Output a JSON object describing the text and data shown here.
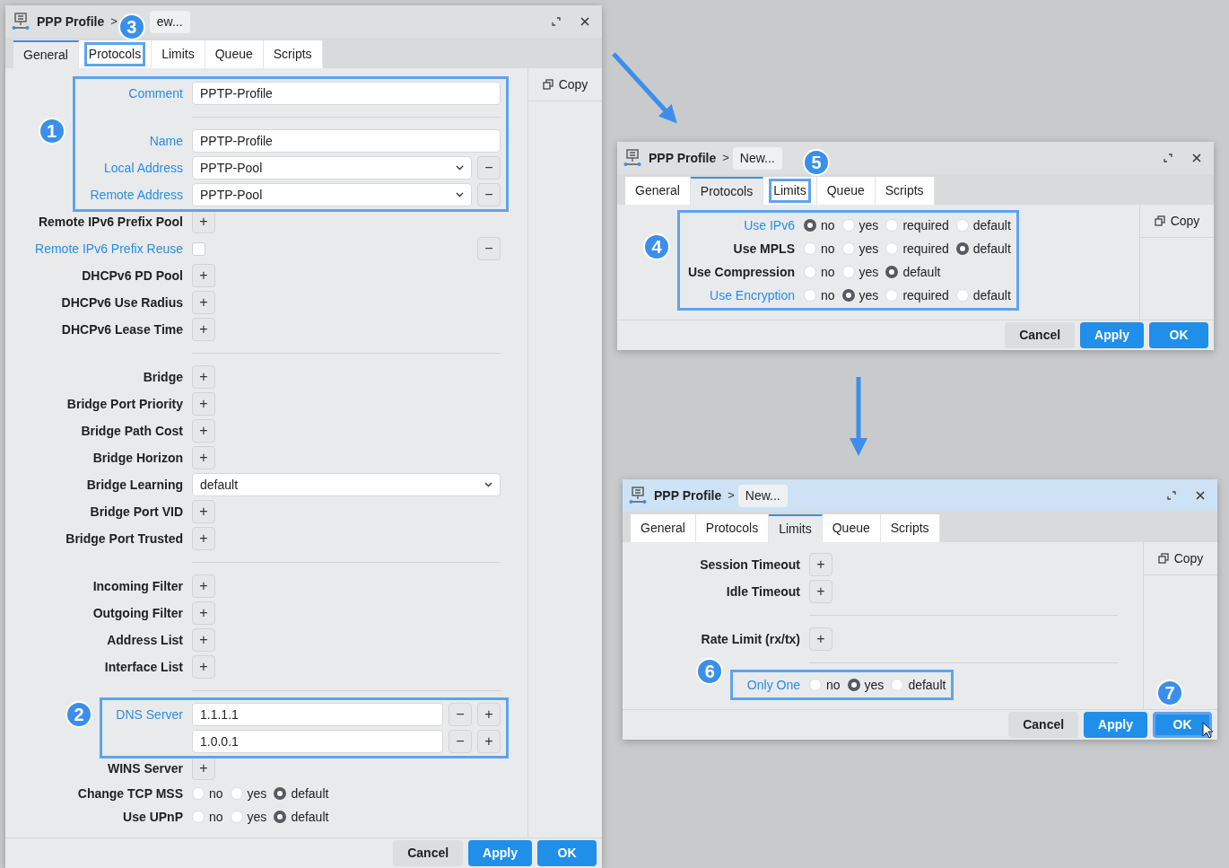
{
  "windows": [
    {
      "active": false,
      "title": "PPP Profile",
      "separator": ">",
      "breadcrumb": "ew...",
      "tabs": [
        {
          "label": "General",
          "selected": true,
          "outlined": false
        },
        {
          "label": "Protocols",
          "selected": false,
          "outlined": true,
          "badge": "3"
        },
        {
          "label": "Limits",
          "selected": false,
          "outlined": false
        },
        {
          "label": "Queue",
          "selected": false,
          "outlined": false
        },
        {
          "label": "Scripts",
          "selected": false,
          "outlined": false
        }
      ],
      "side_button": "Copy",
      "rows": [
        {
          "kind": "group",
          "badge": "1",
          "rows": [
            {
              "kind": "field",
              "label": "Comment",
              "set": true,
              "value": "PPTP-Profile",
              "actions": []
            },
            {
              "kind": "divider"
            },
            {
              "kind": "field",
              "label": "Name",
              "set": true,
              "value": "PPTP-Profile",
              "actions": []
            },
            {
              "kind": "select",
              "label": "Local Address",
              "set": true,
              "value": "PPTP-Pool",
              "actions": [
                "−"
              ]
            },
            {
              "kind": "select",
              "label": "Remote Address",
              "set": true,
              "value": "PPTP-Pool",
              "actions": [
                "−"
              ]
            }
          ]
        },
        {
          "kind": "empty",
          "label": "Remote IPv6 Prefix Pool",
          "set": false,
          "actions": [
            "+"
          ]
        },
        {
          "kind": "checkbox",
          "label": "Remote IPv6 Prefix Reuse",
          "set": true,
          "checked": false,
          "actions": [
            "−"
          ]
        },
        {
          "kind": "empty",
          "label": "DHCPv6 PD Pool",
          "set": false,
          "actions": [
            "+"
          ]
        },
        {
          "kind": "empty",
          "label": "DHCPv6 Use Radius",
          "set": false,
          "actions": [
            "+"
          ]
        },
        {
          "kind": "empty",
          "label": "DHCPv6 Lease Time",
          "set": false,
          "actions": [
            "+"
          ]
        },
        {
          "kind": "divider"
        },
        {
          "kind": "empty",
          "label": "Bridge",
          "set": false,
          "actions": [
            "+"
          ]
        },
        {
          "kind": "empty",
          "label": "Bridge Port Priority",
          "set": false,
          "actions": [
            "+"
          ]
        },
        {
          "kind": "empty",
          "label": "Bridge Path Cost",
          "set": false,
          "actions": [
            "+"
          ]
        },
        {
          "kind": "empty",
          "label": "Bridge Horizon",
          "set": false,
          "actions": [
            "+"
          ]
        },
        {
          "kind": "select",
          "label": "Bridge Learning",
          "set": false,
          "value": "default",
          "actions": []
        },
        {
          "kind": "empty",
          "label": "Bridge Port VID",
          "set": false,
          "actions": [
            "+"
          ]
        },
        {
          "kind": "empty",
          "label": "Bridge Port Trusted",
          "set": false,
          "actions": [
            "+"
          ]
        },
        {
          "kind": "divider"
        },
        {
          "kind": "empty",
          "label": "Incoming Filter",
          "set": false,
          "actions": [
            "+"
          ]
        },
        {
          "kind": "empty",
          "label": "Outgoing Filter",
          "set": false,
          "actions": [
            "+"
          ]
        },
        {
          "kind": "empty",
          "label": "Address List",
          "set": false,
          "actions": [
            "+"
          ]
        },
        {
          "kind": "empty",
          "label": "Interface List",
          "set": false,
          "actions": [
            "+"
          ]
        },
        {
          "kind": "divider"
        },
        {
          "kind": "group",
          "badge": "2",
          "rows": [
            {
              "kind": "field",
              "label": "DNS Server",
              "set": true,
              "value": "1.1.1.1",
              "actions": [
                "−",
                "+"
              ]
            },
            {
              "kind": "field",
              "value": "1.0.0.1",
              "actions": [
                "−",
                "+"
              ]
            }
          ]
        },
        {
          "kind": "empty",
          "label": "WINS Server",
          "set": false,
          "actions": [
            "+"
          ]
        },
        {
          "kind": "radio",
          "label": "Change TCP MSS",
          "set": false,
          "options": [
            {
              "label": "no",
              "selected": false
            },
            {
              "label": "yes",
              "selected": false
            },
            {
              "label": "default",
              "selected": true
            }
          ]
        },
        {
          "kind": "radio",
          "label": "Use UPnP",
          "set": false,
          "options": [
            {
              "label": "no",
              "selected": false
            },
            {
              "label": "yes",
              "selected": false
            },
            {
              "label": "default",
              "selected": true
            }
          ]
        }
      ],
      "buttons": [
        {
          "label": "Cancel",
          "kind": "secondary",
          "outlined": false
        },
        {
          "label": "Apply",
          "kind": "primary",
          "outlined": false
        },
        {
          "label": "OK",
          "kind": "primary",
          "outlined": false
        }
      ]
    },
    {
      "active": false,
      "title": "PPP Profile",
      "separator": ">",
      "breadcrumb": "New...",
      "tabs": [
        {
          "label": "General",
          "selected": false,
          "outlined": false
        },
        {
          "label": "Protocols",
          "selected": true,
          "outlined": false
        },
        {
          "label": "Limits",
          "selected": false,
          "outlined": true,
          "badge": "5"
        },
        {
          "label": "Queue",
          "selected": false,
          "outlined": false
        },
        {
          "label": "Scripts",
          "selected": false,
          "outlined": false
        }
      ],
      "side_button": "Copy",
      "rows": [
        {
          "kind": "group",
          "badge": "4",
          "rows": [
            {
              "kind": "radio",
              "label": "Use IPv6",
              "set": true,
              "options": [
                {
                  "label": "no",
                  "selected": true
                },
                {
                  "label": "yes",
                  "selected": false
                },
                {
                  "label": "required",
                  "selected": false
                },
                {
                  "label": "default",
                  "selected": false
                }
              ]
            },
            {
              "kind": "radio",
              "label": "Use MPLS",
              "set": false,
              "options": [
                {
                  "label": "no",
                  "selected": false
                },
                {
                  "label": "yes",
                  "selected": false
                },
                {
                  "label": "required",
                  "selected": false
                },
                {
                  "label": "default",
                  "selected": true
                }
              ]
            },
            {
              "kind": "radio",
              "label": "Use Compression",
              "set": false,
              "options": [
                {
                  "label": "no",
                  "selected": false
                },
                {
                  "label": "yes",
                  "selected": false
                },
                {
                  "label": "default",
                  "selected": true
                }
              ]
            },
            {
              "kind": "radio",
              "label": "Use Encryption",
              "set": true,
              "options": [
                {
                  "label": "no",
                  "selected": false
                },
                {
                  "label": "yes",
                  "selected": true
                },
                {
                  "label": "required",
                  "selected": false
                },
                {
                  "label": "default",
                  "selected": false
                }
              ]
            }
          ]
        }
      ],
      "buttons": [
        {
          "label": "Cancel",
          "kind": "secondary",
          "outlined": false
        },
        {
          "label": "Apply",
          "kind": "primary",
          "outlined": false
        },
        {
          "label": "OK",
          "kind": "primary",
          "outlined": false
        }
      ]
    },
    {
      "active": true,
      "title": "PPP Profile",
      "separator": ">",
      "breadcrumb": "New...",
      "tabs": [
        {
          "label": "General",
          "selected": false,
          "outlined": false
        },
        {
          "label": "Protocols",
          "selected": false,
          "outlined": false
        },
        {
          "label": "Limits",
          "selected": true,
          "outlined": false
        },
        {
          "label": "Queue",
          "selected": false,
          "outlined": false
        },
        {
          "label": "Scripts",
          "selected": false,
          "outlined": false
        }
      ],
      "side_button": "Copy",
      "rows": [
        {
          "kind": "empty",
          "label": "Session Timeout",
          "set": false,
          "actions": [
            "+"
          ]
        },
        {
          "kind": "empty",
          "label": "Idle Timeout",
          "set": false,
          "actions": [
            "+"
          ]
        },
        {
          "kind": "divider"
        },
        {
          "kind": "empty",
          "label": "Rate Limit (rx/tx)",
          "set": false,
          "actions": [
            "+"
          ]
        },
        {
          "kind": "divider"
        },
        {
          "kind": "group",
          "badge": "6",
          "rows": [
            {
              "kind": "radio",
              "label": "Only One",
              "set": true,
              "options": [
                {
                  "label": "no",
                  "selected": false
                },
                {
                  "label": "yes",
                  "selected": true
                },
                {
                  "label": "default",
                  "selected": false
                }
              ]
            }
          ]
        }
      ],
      "buttons": [
        {
          "label": "Cancel",
          "kind": "secondary",
          "outlined": false
        },
        {
          "label": "Apply",
          "kind": "primary",
          "outlined": false
        },
        {
          "label": "OK",
          "kind": "primary",
          "outlined": true,
          "badge": "7"
        }
      ]
    }
  ]
}
